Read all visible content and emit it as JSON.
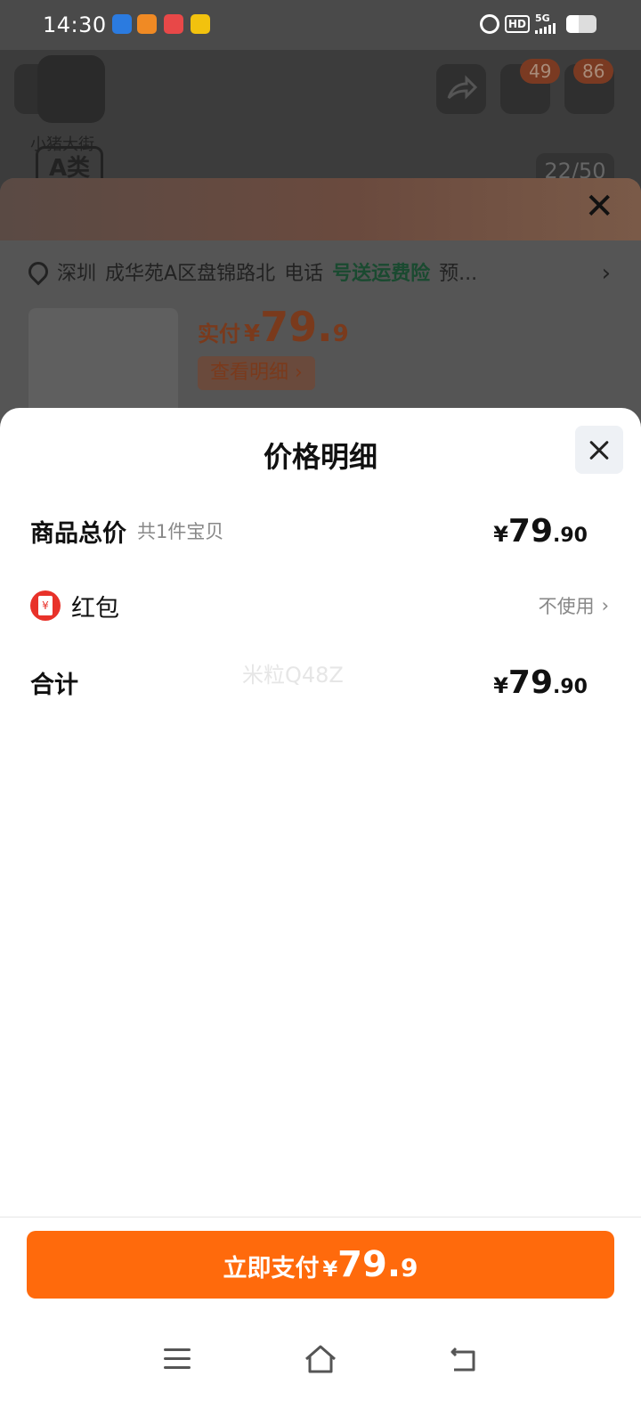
{
  "status_bar": {
    "time": "14:30",
    "hd": "HD",
    "network": "5G"
  },
  "background_page": {
    "logo_text": "小猪大街",
    "category_tag": "A类",
    "image_counter": "22/50",
    "cart_badge": "49",
    "message_badge": "86",
    "address": {
      "prefix": "深圳",
      "text": "成华苑A区盘锦路北",
      "extra": "电话",
      "insurance": "号送运费险",
      "suffix": "预..."
    },
    "paid_label": "实付",
    "paid_currency": "¥",
    "paid_int": "79.",
    "paid_dec": "9",
    "detail_link": "查看明细 ›"
  },
  "sheet": {
    "title": "价格明细",
    "goods_total": {
      "label": "商品总价",
      "sub": "共1件宝贝",
      "currency": "¥",
      "int": "79",
      "dec": ".90"
    },
    "red_packet": {
      "label": "红包",
      "value": "不使用"
    },
    "total": {
      "label": "合计",
      "currency": "¥",
      "int": "79",
      "dec": ".90"
    },
    "watermark": "米粒Q48Z"
  },
  "pay_button": {
    "label": "立即支付",
    "currency": "¥",
    "int": "79.",
    "dec": "9"
  },
  "colors": {
    "accent": "#ff6a0c",
    "red_packet": "#e8322a",
    "text": "#111111",
    "muted": "#888888"
  }
}
